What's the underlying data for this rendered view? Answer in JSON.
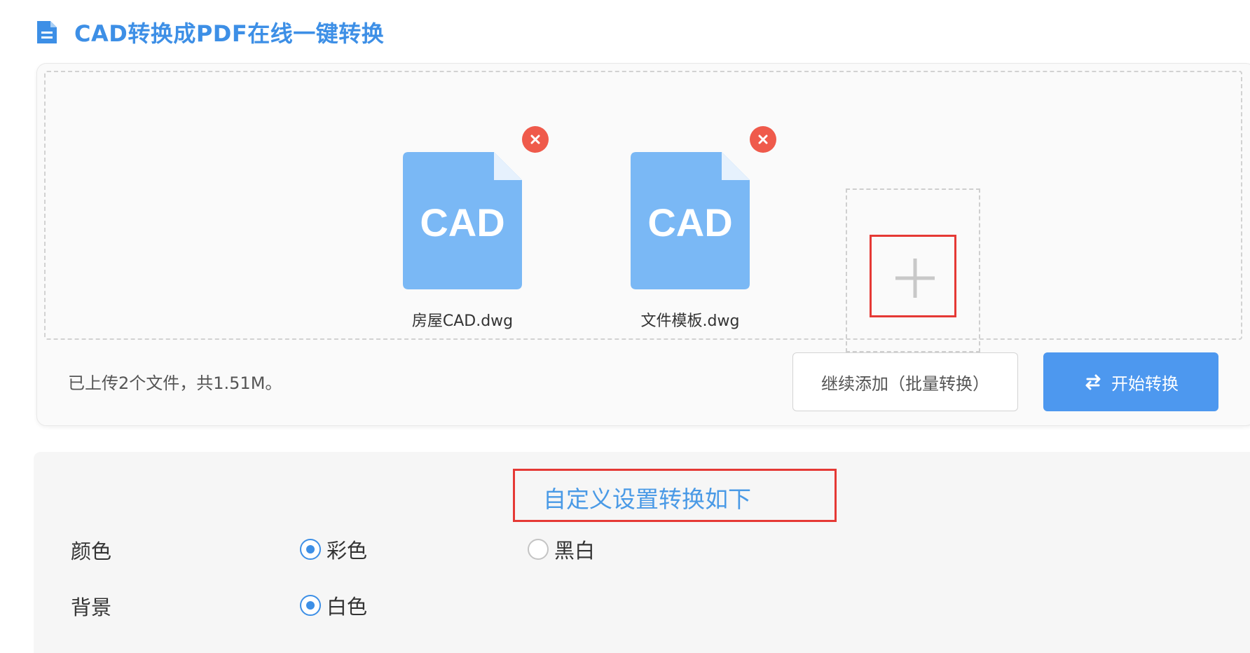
{
  "header": {
    "icon": "document-icon",
    "title": "CAD转换成PDF在线一键转换"
  },
  "upload": {
    "files": [
      {
        "icon_text": "CAD",
        "name": "房屋CAD.dwg"
      },
      {
        "icon_text": "CAD",
        "name": "文件模板.dwg"
      }
    ],
    "summary": "已上传2个文件，共1.51M。",
    "continue_label": "继续添加（批量转换）",
    "start_label": "开始转换"
  },
  "settings": {
    "title": "自定义设置转换如下",
    "color": {
      "label": "颜色",
      "options": [
        {
          "label": "彩色",
          "checked": true
        },
        {
          "label": "黑白",
          "checked": false
        }
      ]
    },
    "background": {
      "label": "背景",
      "options": [
        {
          "label": "白色",
          "checked": true
        }
      ]
    }
  },
  "colors": {
    "accent": "#3d8fe6",
    "button_primary": "#4d98ef",
    "file_icon": "#7ab8f5",
    "remove": "#ef5a4b",
    "highlight": "#e53935"
  }
}
